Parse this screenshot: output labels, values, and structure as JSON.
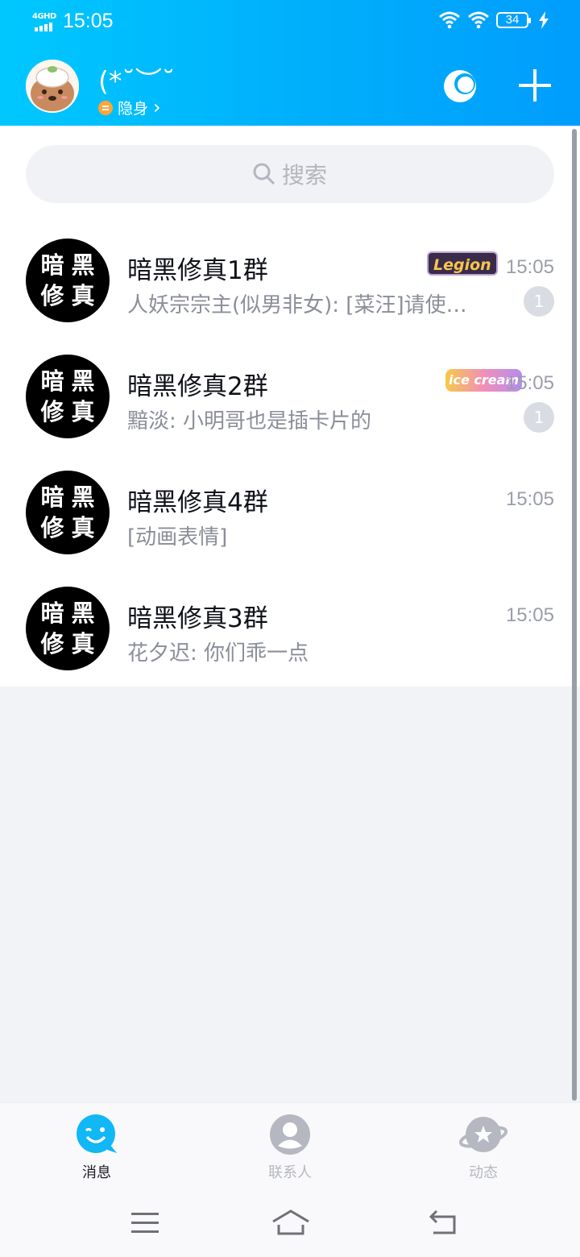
{
  "status_bar": {
    "network": "4GHD",
    "time": "15:05",
    "battery": "34"
  },
  "header": {
    "nickname": "(*˘︶˘",
    "status_label": "隐身",
    "status_chevron": "›"
  },
  "search": {
    "placeholder": "搜索"
  },
  "conversations": [
    {
      "title": "暗黑修真1群",
      "preview": "人妖宗宗主(似男非女): [菜汪]请使…",
      "time": "15:05",
      "unread": "1",
      "tag": "Legion",
      "avatar_text": [
        "暗",
        "黑",
        "修",
        "真"
      ]
    },
    {
      "title": "暗黑修真2群",
      "preview": "黯淡: 小明哥也是插卡片的",
      "time": "15:05",
      "unread": "1",
      "tag": "ice cream",
      "avatar_text": [
        "暗",
        "黑",
        "修",
        "真"
      ]
    },
    {
      "title": "暗黑修真4群",
      "preview": "[动画表情]",
      "time": "15:05",
      "avatar_text": [
        "暗",
        "黑",
        "修",
        "真"
      ]
    },
    {
      "title": "暗黑修真3群",
      "preview": "花夕迟: 你们乖一点",
      "time": "15:05",
      "avatar_text": [
        "暗",
        "黑",
        "修",
        "真"
      ]
    }
  ],
  "tabs": [
    {
      "label": "消息",
      "active": true
    },
    {
      "label": "联系人",
      "active": false
    },
    {
      "label": "动态",
      "active": false
    }
  ],
  "colors": {
    "accent": "#00b0fb",
    "tab_active": "#12b7f5",
    "tab_inactive": "#b5b8c1",
    "unread_badge": "#d9dce3"
  },
  "icons": [
    "signal-icon",
    "wifi-icon",
    "battery-icon",
    "charging-icon",
    "moon-icon",
    "plus-icon",
    "search-icon",
    "chat-icon",
    "contacts-icon",
    "planet-icon",
    "menu-icon",
    "home-icon",
    "back-icon"
  ]
}
